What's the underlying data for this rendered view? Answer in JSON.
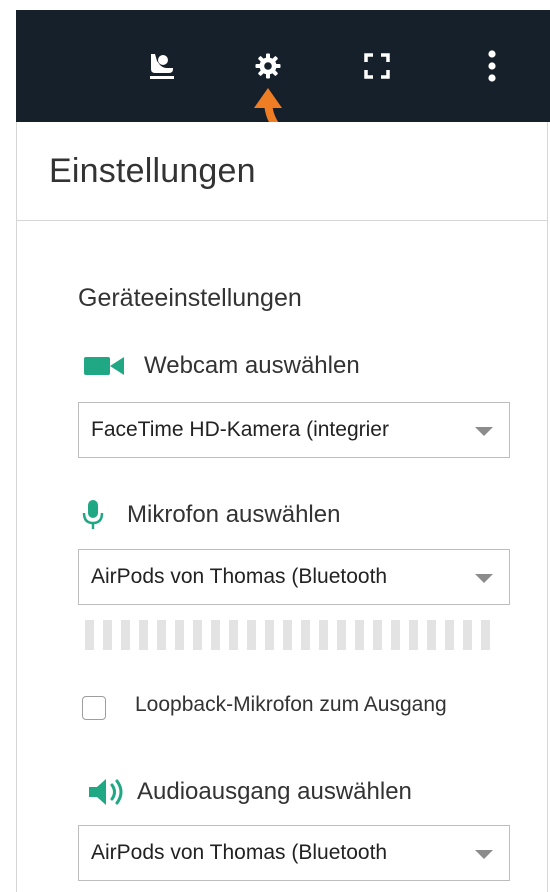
{
  "toolbar": {
    "icons": [
      "user-cast-icon",
      "gear-icon",
      "fullscreen-icon",
      "more-vertical-icon"
    ]
  },
  "settings": {
    "title": "Einstellungen",
    "section_title": "Geräteeinstellungen",
    "webcam": {
      "label": "Webcam auswählen",
      "selected": "FaceTime HD-Kamera (integrier"
    },
    "microphone": {
      "label": "Mikrofon auswählen",
      "selected": "AirPods von Thomas (Bluetooth",
      "level_fraction": 0
    },
    "loopback": {
      "label": "Loopback-Mikrofon zum Ausgang",
      "checked": false
    },
    "audio_output": {
      "label": "Audioausgang auswählen",
      "selected": "AirPods von Thomas (Bluetooth"
    }
  },
  "colors": {
    "toolbar_bg": "#16202a",
    "accent_green": "#1fa883",
    "arrow_orange": "#ef7d24"
  }
}
